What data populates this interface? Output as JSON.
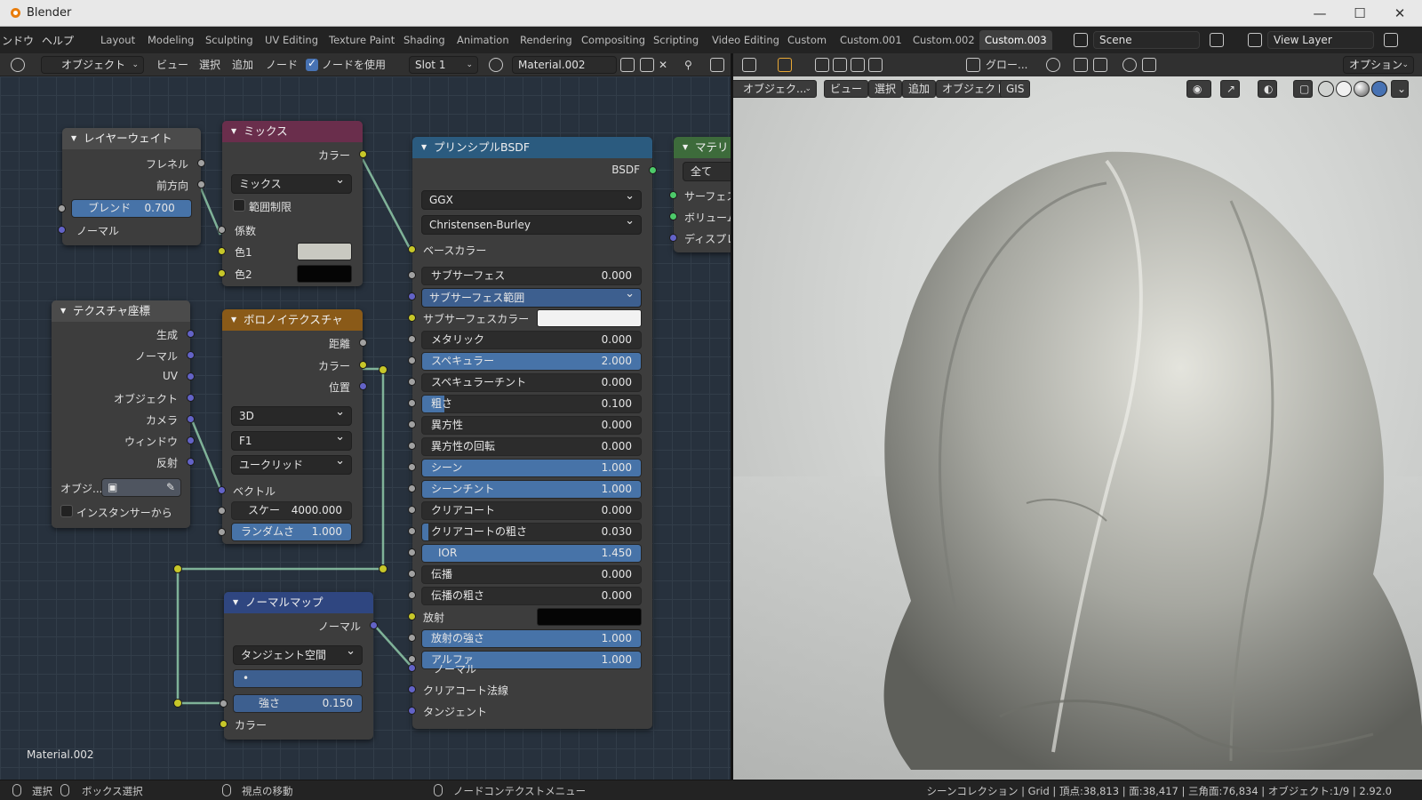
{
  "window": {
    "title": "Blender",
    "minimize": "—",
    "maximize": "☐",
    "close": "✕"
  },
  "menu": {
    "window": "ンドウ",
    "help": "ヘルプ"
  },
  "workspaces": [
    "Layout",
    "Modeling",
    "Sculpting",
    "UV Editing",
    "Texture Paint",
    "Shading",
    "Animation",
    "Rendering",
    "Compositing",
    "Scripting",
    "Video Editing",
    "Custom",
    "Custom.001",
    "Custom.002",
    "Custom.003"
  ],
  "active_workspace": "Custom.003",
  "scene": {
    "name": "Scene",
    "view_layer": "View Layer"
  },
  "node_header": {
    "object_mode": "オブジェクト",
    "view": "ビュー",
    "select": "選択",
    "add": "追加",
    "node": "ノード",
    "use_nodes": "ノードを使用",
    "slot": "Slot 1",
    "material": "Material.002"
  },
  "nodes": {
    "layer_weight": {
      "title": "レイヤーウェイト",
      "fresnel": "フレネル",
      "facing": "前方向",
      "blend_label": "ブレンド",
      "blend_value": "0.700",
      "normal": "ノーマル"
    },
    "mix": {
      "title": "ミックス",
      "color_out": "カラー",
      "mode": "ミックス",
      "clamp": "範囲制限",
      "fac": "係数",
      "color1": "色1",
      "color2": "色2",
      "color1_hex": "#c9c9c1",
      "color2_hex": "#050505"
    },
    "tex_coord": {
      "title": "テクスチャ座標",
      "generated": "生成",
      "normal": "ノーマル",
      "uv": "UV",
      "object": "オブジェクト",
      "camera": "カメラ",
      "window": "ウィンドウ",
      "reflection": "反射",
      "object_field": "オブジ...",
      "from_instancer": "インスタンサーから"
    },
    "voronoi": {
      "title": "ボロノイテクスチャ",
      "distance": "距離",
      "color": "カラー",
      "position": "位置",
      "dims": "3D",
      "feature": "F1",
      "metric": "ユークリッド",
      "vector": "ベクトル",
      "scale_label": "スケー",
      "scale_value": "4000.000",
      "random_label": "ランダムさ",
      "random_value": "1.000"
    },
    "normal_map": {
      "title": "ノーマルマップ",
      "normal_out": "ノーマル",
      "space": "タンジェント空間",
      "uvmap": "•",
      "strength_label": "強さ",
      "strength_value": "0.150",
      "color": "カラー"
    },
    "bsdf": {
      "title": "プリンシプルBSDF",
      "output": "BSDF",
      "distribution": "GGX",
      "subsurface_method": "Christensen-Burley",
      "base_color": "ベースカラー",
      "fields": [
        {
          "label": "サブサーフェス",
          "value": "0.000",
          "fill": 0
        },
        {
          "label": "サブサーフェス範囲",
          "value": "",
          "fill": 1
        },
        {
          "label": "サブサーフェスカラー",
          "value": "",
          "fill": 0
        },
        {
          "label": "メタリック",
          "value": "0.000",
          "fill": 0
        },
        {
          "label": "スペキュラー",
          "value": "2.000",
          "fill": 1
        },
        {
          "label": "スペキュラーチント",
          "value": "0.000",
          "fill": 0
        },
        {
          "label": "粗さ",
          "value": "0.100",
          "fill": 0.1
        },
        {
          "label": "異方性",
          "value": "0.000",
          "fill": 0
        },
        {
          "label": "異方性の回転",
          "value": "0.000",
          "fill": 0
        },
        {
          "label": "シーン",
          "value": "1.000",
          "fill": 1
        },
        {
          "label": "シーンチント",
          "value": "1.000",
          "fill": 1
        },
        {
          "label": "クリアコート",
          "value": "0.000",
          "fill": 0
        },
        {
          "label": "クリアコートの粗さ",
          "value": "0.030",
          "fill": 0.03
        },
        {
          "label": "IOR",
          "value": "1.450",
          "fill": 1
        },
        {
          "label": "伝播",
          "value": "0.000",
          "fill": 0
        },
        {
          "label": "伝播の粗さ",
          "value": "0.000",
          "fill": 0
        },
        {
          "label": "放射",
          "value": "",
          "fill": 0
        },
        {
          "label": "放射の強さ",
          "value": "1.000",
          "fill": 1
        },
        {
          "label": "アルファ",
          "value": "1.000",
          "fill": 1
        }
      ],
      "normal": "ノーマル",
      "clearcoat_normal": "クリアコート法線",
      "tangent": "タンジェント"
    },
    "material_output": {
      "title": "マテリ",
      "target": "全て",
      "surface": "サーフェス",
      "volume": "ボリューム",
      "displacement": "ディスプレ"
    }
  },
  "node_editor_label": "Material.002",
  "viewport_header": {
    "object_mode": "オブジェク...",
    "view": "ビュー",
    "select": "選択",
    "add": "追加",
    "object": "オブジェクト",
    "gis": "GIS",
    "global": "グロー...",
    "options": "オプション"
  },
  "statusbar": {
    "select": "選択",
    "box_select": "ボックス選択",
    "move_view": "視点の移動",
    "node_context": "ノードコンテクストメニュー",
    "stats": "シーンコレクション | Grid | 頂点:38,813 | 面:38,417 | 三角面:76,834 | オブジェクト:1/9 | 2.92.0"
  },
  "colors": {
    "accent": "#4772b3",
    "blender_orange": "#e87d0d"
  }
}
